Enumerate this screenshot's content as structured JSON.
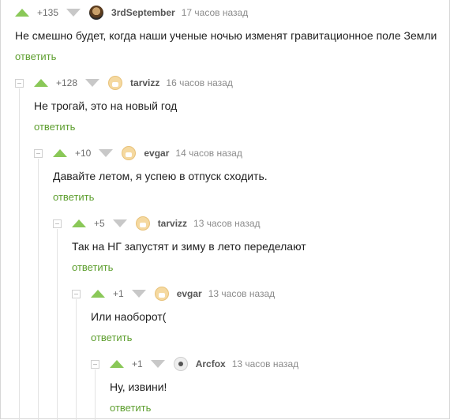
{
  "comments": [
    {
      "rating": "+135",
      "author": "3rdSeptember",
      "time": "17 часов назад",
      "text": "Не смешно будет, когда наши ученые ночью изменят гравитационное поле Земли",
      "reply": "ответить"
    },
    {
      "rating": "+128",
      "author": "tarvizz",
      "time": "16 часов назад",
      "text": "Не трогай, это на новый год",
      "reply": "ответить"
    },
    {
      "rating": "+10",
      "author": "evgar",
      "time": "14 часов назад",
      "text": "Давайте летом, я успею в отпуск сходить.",
      "reply": "ответить"
    },
    {
      "rating": "+5",
      "author": "tarvizz",
      "time": "13 часов назад",
      "text": "Так на НГ запустят и зиму в лето переделают",
      "reply": "ответить"
    },
    {
      "rating": "+1",
      "author": "evgar",
      "time": "13 часов назад",
      "text": "Или наоборот(",
      "reply": "ответить"
    },
    {
      "rating": "+1",
      "author": "Arcfox",
      "time": "13 часов назад",
      "text": "Ну, извини!",
      "reply": "ответить"
    }
  ],
  "colors": {
    "upvote": "#8ac858",
    "downvote": "#c8c8c8",
    "reply_link": "#5d9e2e"
  },
  "icons": {
    "upvote": "triangle-up",
    "downvote": "triangle-down",
    "collapse": "minus-square"
  }
}
